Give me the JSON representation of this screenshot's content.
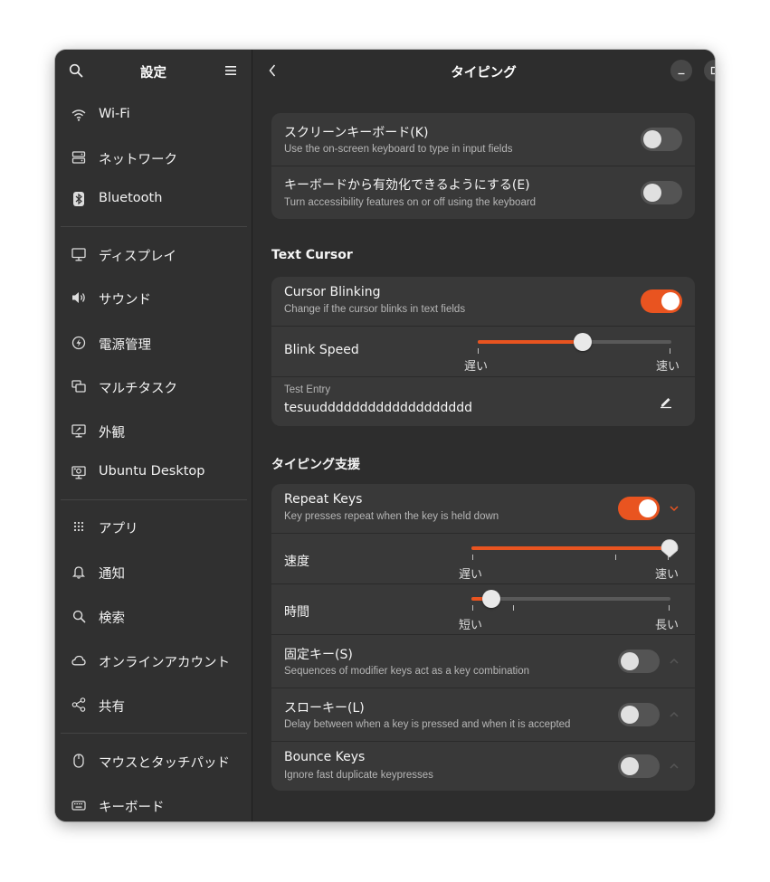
{
  "sidebar": {
    "title": "設定",
    "items": [
      {
        "label": "Wi-Fi",
        "icon": "wifi-icon"
      },
      {
        "label": "ネットワーク",
        "icon": "network-icon"
      },
      {
        "label": "Bluetooth",
        "icon": "bluetooth-icon"
      },
      {
        "label": "ディスプレイ",
        "icon": "display-icon"
      },
      {
        "label": "サウンド",
        "icon": "sound-icon"
      },
      {
        "label": "電源管理",
        "icon": "power-icon"
      },
      {
        "label": "マルチタスク",
        "icon": "multitasking-icon"
      },
      {
        "label": "外観",
        "icon": "appearance-icon"
      },
      {
        "label": "Ubuntu Desktop",
        "icon": "ubuntu-desktop-icon"
      },
      {
        "label": "アプリ",
        "icon": "apps-grid-icon"
      },
      {
        "label": "通知",
        "icon": "bell-icon"
      },
      {
        "label": "検索",
        "icon": "search-icon"
      },
      {
        "label": "オンラインアカウント",
        "icon": "cloud-icon"
      },
      {
        "label": "共有",
        "icon": "share-icon"
      },
      {
        "label": "マウスとタッチパッド",
        "icon": "mouse-icon"
      },
      {
        "label": "キーボード",
        "icon": "keyboard-icon"
      }
    ]
  },
  "main": {
    "title": "タイピング",
    "top_card": [
      {
        "title": "スクリーンキーボード(K)",
        "subtitle": "Use the on-screen keyboard to type in input fields",
        "enabled": false
      },
      {
        "title": "キーボードから有効化できるようにする(E)",
        "subtitle": "Turn accessibility features on or off using the keyboard",
        "enabled": false
      }
    ],
    "text_cursor": {
      "heading": "Text Cursor",
      "blinking": {
        "title": "Cursor Blinking",
        "subtitle": "Change if the cursor blinks in text fields",
        "enabled": true
      },
      "blink_speed": {
        "title": "Blink Speed",
        "min_label": "遅い",
        "max_label": "速い",
        "value": 0.54
      },
      "test_entry": {
        "label": "Test Entry",
        "value": "tesuuddddddddddddddddddd"
      }
    },
    "typing_assist": {
      "heading": "タイピング支援",
      "repeat_keys": {
        "title": "Repeat Keys",
        "subtitle": "Key presses repeat when the key is held down",
        "enabled": true
      },
      "speed": {
        "title": "速度",
        "min_label": "遅い",
        "max_label": "速い",
        "value": 1.0
      },
      "delay": {
        "title": "時間",
        "min_label": "短い",
        "max_label": "長い",
        "value": 0.1
      },
      "sticky_keys": {
        "title": "固定キー(S)",
        "subtitle": "Sequences of modifier keys act as a key combination",
        "enabled": false
      },
      "slow_keys": {
        "title": "スローキー(L)",
        "subtitle": "Delay between when a key is pressed and when it is accepted",
        "enabled": false
      },
      "bounce_keys": {
        "title": "Bounce Keys",
        "subtitle": "Ignore fast duplicate keypresses",
        "enabled": false
      }
    }
  },
  "colors": {
    "accent": "#e95420",
    "window_bg": "#2d2d2d",
    "card_bg": "#393939"
  }
}
